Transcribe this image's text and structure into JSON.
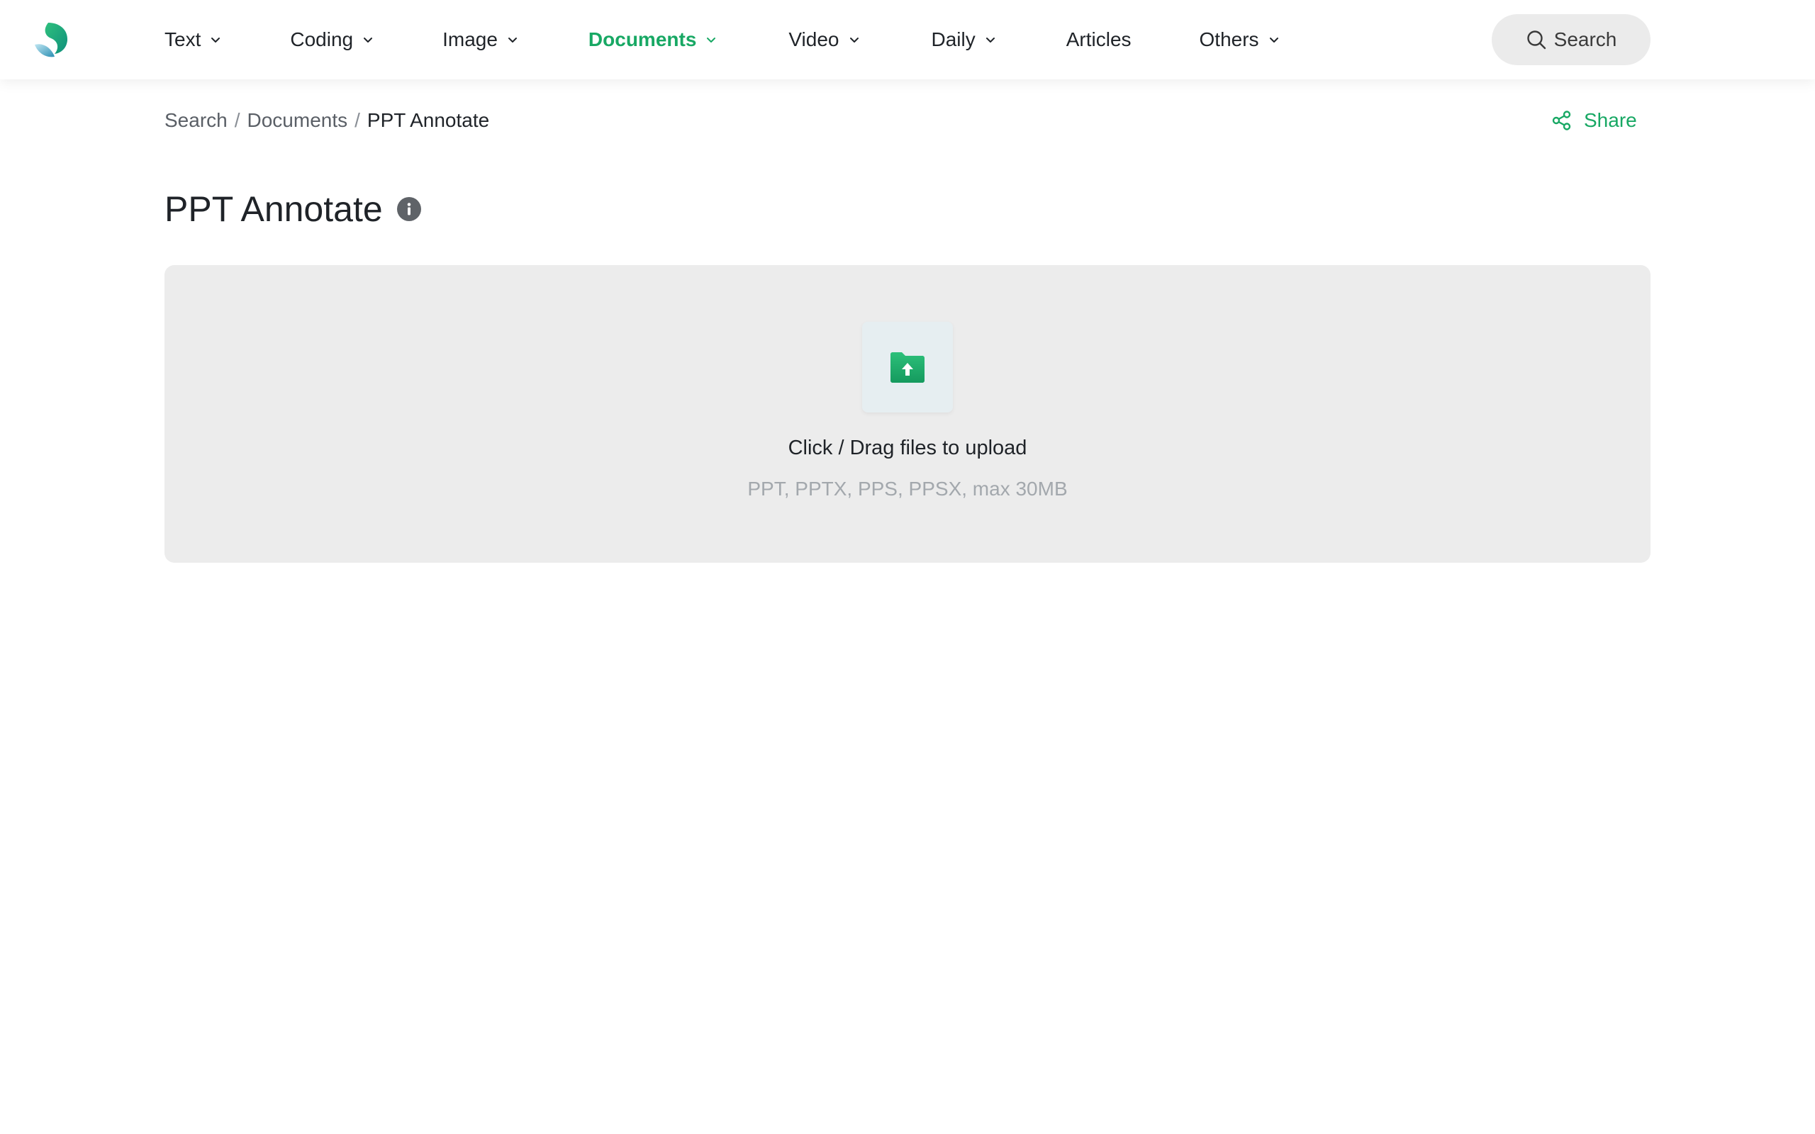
{
  "nav": {
    "items": [
      {
        "label": "Text"
      },
      {
        "label": "Coding"
      },
      {
        "label": "Image"
      },
      {
        "label": "Documents"
      },
      {
        "label": "Video"
      },
      {
        "label": "Daily"
      },
      {
        "label": "Articles"
      },
      {
        "label": "Others"
      }
    ],
    "active": "Documents",
    "search_label": "Search"
  },
  "breadcrumb": {
    "items": [
      "Search",
      "Documents",
      "PPT Annotate"
    ],
    "separator": "/"
  },
  "share_label": "Share",
  "page": {
    "title": "PPT Annotate"
  },
  "upload": {
    "title": "Click / Drag files to upload",
    "hint": "PPT, PPTX, PPS, PPSX, max 30MB"
  },
  "colors": {
    "accent": "#18a864",
    "upload_bg": "#ececec",
    "search_bg": "#ebebeb"
  },
  "icons": {
    "logo": "brand-logo",
    "chevron": "chevron-down-icon",
    "search": "search-icon",
    "share": "share-icon",
    "info": "info-icon",
    "upload": "folder-upload-icon"
  }
}
